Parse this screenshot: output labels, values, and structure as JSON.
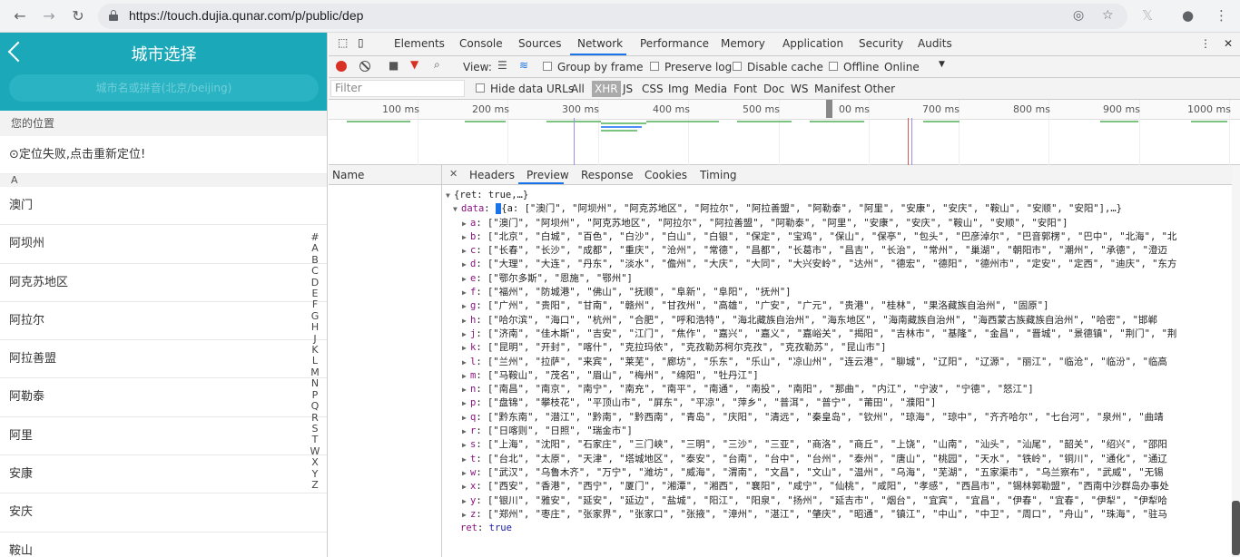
{
  "browser": {
    "url": "https://touch.dujia.qunar.com/p/public/dep",
    "back_icon": "←",
    "forward_icon": "→",
    "reload_icon": "↻"
  },
  "app": {
    "title": "城市选择",
    "search_placeholder": "城市名或拼音(北京/beijing)",
    "location_section": "您的位置",
    "location_status": "⊙定位失败,点击重新定位!",
    "letter_section": "A",
    "cities": [
      "澳门",
      "阿坝州",
      "阿克苏地区",
      "阿拉尔",
      "阿拉善盟",
      "阿勒泰",
      "阿里",
      "安康",
      "安庆",
      "鞍山"
    ],
    "alpha_index": [
      "#",
      "A",
      "B",
      "C",
      "D",
      "E",
      "F",
      "G",
      "H",
      "J",
      "K",
      "L",
      "M",
      "N",
      "P",
      "Q",
      "R",
      "S",
      "T",
      "W",
      "X",
      "Y",
      "Z"
    ]
  },
  "devtools": {
    "tabs": [
      "Elements",
      "Console",
      "Sources",
      "Network",
      "Performance",
      "Memory",
      "Application",
      "Security",
      "Audits"
    ],
    "active_tab": "Network",
    "toolbar": {
      "view_label": "View:",
      "group_by_frame": "Group by frame",
      "preserve_log": "Preserve log",
      "disable_cache": "Disable cache",
      "offline": "Offline",
      "throttle": "Online"
    },
    "filter": {
      "placeholder": "Filter",
      "hide_data_urls": "Hide data URLs",
      "types": [
        "All",
        "XHR",
        "JS",
        "CSS",
        "Img",
        "Media",
        "Font",
        "Doc",
        "WS",
        "Manifest",
        "Other"
      ],
      "active_type": "XHR"
    },
    "timeline_labels": [
      "100 ms",
      "200 ms",
      "300 ms",
      "400 ms",
      "500 ms",
      "00 ms",
      "700 ms",
      "800 ms",
      "900 ms",
      "1000 ms"
    ],
    "name_header": "Name",
    "detail_tabs": [
      "Headers",
      "Preview",
      "Response",
      "Cookies",
      "Timing"
    ],
    "active_detail_tab": "Preview",
    "preview": {
      "root": "{ret: true,…}",
      "data_line": "{a: [\"澳门\", \"阿坝州\", \"阿克苏地区\", \"阿拉尔\", \"阿拉善盟\", \"阿勒泰\", \"阿里\", \"安康\", \"安庆\", \"鞍山\", \"安顺\", \"安阳\"],…}",
      "rows": [
        {
          "k": "a",
          "v": "[\"澳门\", \"阿坝州\", \"阿克苏地区\", \"阿拉尔\", \"阿拉善盟\", \"阿勒泰\", \"阿里\", \"安康\", \"安庆\", \"鞍山\", \"安顺\", \"安阳\"]"
        },
        {
          "k": "b",
          "v": "[\"北京\", \"白城\", \"百色\", \"白沙\", \"白山\", \"白银\", \"保定\", \"宝鸡\", \"保山\", \"保亭\", \"包头\", \"巴彦淖尔\", \"巴音郭楞\", \"巴中\", \"北海\", \"北"
        },
        {
          "k": "c",
          "v": "[\"长春\", \"长沙\", \"成都\", \"重庆\", \"沧州\", \"常德\", \"昌都\", \"长葛市\", \"昌吉\", \"长治\", \"常州\", \"巢湖\", \"朝阳市\", \"潮州\", \"承德\", \"澄迈"
        },
        {
          "k": "d",
          "v": "[\"大理\", \"大连\", \"丹东\", \"淡水\", \"儋州\", \"大庆\", \"大同\", \"大兴安岭\", \"达州\", \"德宏\", \"德阳\", \"德州市\", \"定安\", \"定西\", \"迪庆\", \"东方"
        },
        {
          "k": "e",
          "v": "[\"鄂尔多斯\", \"恩施\", \"鄂州\"]"
        },
        {
          "k": "f",
          "v": "[\"福州\", \"防城港\", \"佛山\", \"抚顺\", \"阜新\", \"阜阳\", \"抚州\"]"
        },
        {
          "k": "g",
          "v": "[\"广州\", \"贵阳\", \"甘南\", \"赣州\", \"甘孜州\", \"高雄\", \"广安\", \"广元\", \"贵港\", \"桂林\", \"果洛藏族自治州\", \"固原\"]"
        },
        {
          "k": "h",
          "v": "[\"哈尔滨\", \"海口\", \"杭州\", \"合肥\", \"呼和浩特\", \"海北藏族自治州\", \"海东地区\", \"海南藏族自治州\", \"海西蒙古族藏族自治州\", \"哈密\", \"邯郸"
        },
        {
          "k": "j",
          "v": "[\"济南\", \"佳木斯\", \"吉安\", \"江门\", \"焦作\", \"嘉兴\", \"嘉义\", \"嘉峪关\", \"揭阳\", \"吉林市\", \"基隆\", \"金昌\", \"晋城\", \"景德镇\", \"荆门\", \"荆"
        },
        {
          "k": "k",
          "v": "[\"昆明\", \"开封\", \"喀什\", \"克拉玛依\", \"克孜勒苏柯尔克孜\", \"克孜勒苏\", \"昆山市\"]"
        },
        {
          "k": "l",
          "v": "[\"兰州\", \"拉萨\", \"来宾\", \"莱芜\", \"廊坊\", \"乐东\", \"乐山\", \"凉山州\", \"连云港\", \"聊城\", \"辽阳\", \"辽源\", \"丽江\", \"临沧\", \"临汾\", \"临高"
        },
        {
          "k": "m",
          "v": "[\"马鞍山\", \"茂名\", \"眉山\", \"梅州\", \"绵阳\", \"牡丹江\"]"
        },
        {
          "k": "n",
          "v": "[\"南昌\", \"南京\", \"南宁\", \"南充\", \"南平\", \"南通\", \"南投\", \"南阳\", \"那曲\", \"内江\", \"宁波\", \"宁德\", \"怒江\"]"
        },
        {
          "k": "p",
          "v": "[\"盘锦\", \"攀枝花\", \"平顶山市\", \"屏东\", \"平凉\", \"萍乡\", \"普洱\", \"普宁\", \"莆田\", \"濮阳\"]"
        },
        {
          "k": "q",
          "v": "[\"黔东南\", \"潜江\", \"黔南\", \"黔西南\", \"青岛\", \"庆阳\", \"清远\", \"秦皇岛\", \"钦州\", \"琼海\", \"琼中\", \"齐齐哈尔\", \"七台河\", \"泉州\", \"曲靖"
        },
        {
          "k": "r",
          "v": "[\"日喀则\", \"日照\", \"瑞金市\"]"
        },
        {
          "k": "s",
          "v": "[\"上海\", \"沈阳\", \"石家庄\", \"三门峡\", \"三明\", \"三沙\", \"三亚\", \"商洛\", \"商丘\", \"上饶\", \"山南\", \"汕头\", \"汕尾\", \"韶关\", \"绍兴\", \"邵阳"
        },
        {
          "k": "t",
          "v": "[\"台北\", \"太原\", \"天津\", \"塔城地区\", \"泰安\", \"台南\", \"台中\", \"台州\", \"泰州\", \"唐山\", \"桃园\", \"天水\", \"铁岭\", \"铜川\", \"通化\", \"通辽"
        },
        {
          "k": "w",
          "v": "[\"武汉\", \"乌鲁木齐\", \"万宁\", \"潍坊\", \"威海\", \"渭南\", \"文昌\", \"文山\", \"温州\", \"乌海\", \"芜湖\", \"五家渠市\", \"乌兰察布\", \"武威\", \"无锡"
        },
        {
          "k": "x",
          "v": "[\"西安\", \"香港\", \"西宁\", \"厦门\", \"湘潭\", \"湘西\", \"襄阳\", \"咸宁\", \"仙桃\", \"咸阳\", \"孝感\", \"西昌市\", \"锡林郭勒盟\", \"西南中沙群岛办事处"
        },
        {
          "k": "y",
          "v": "[\"银川\", \"雅安\", \"延安\", \"延边\", \"盐城\", \"阳江\", \"阳泉\", \"扬州\", \"延吉市\", \"烟台\", \"宜宾\", \"宜昌\", \"伊春\", \"宜春\", \"伊犁\", \"伊犁哈"
        },
        {
          "k": "z",
          "v": "[\"郑州\", \"枣庄\", \"张家界\", \"张家口\", \"张掖\", \"漳州\", \"湛江\", \"肇庆\", \"昭通\", \"镇江\", \"中山\", \"中卫\", \"周口\", \"舟山\", \"珠海\", \"驻马"
        }
      ],
      "ret_key": "ret",
      "ret_value": "true"
    }
  }
}
